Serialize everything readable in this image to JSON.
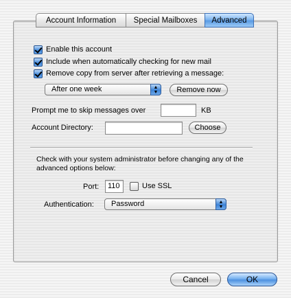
{
  "tabs": [
    {
      "label": "Account Information",
      "selected": false
    },
    {
      "label": "Special Mailboxes",
      "selected": false
    },
    {
      "label": "Advanced",
      "selected": true
    }
  ],
  "options": {
    "enable_account": {
      "label": "Enable this account",
      "checked": true
    },
    "include_auto_check": {
      "label": "Include when automatically checking for new mail",
      "checked": true
    },
    "remove_copy": {
      "label": "Remove copy from server after retrieving a message:",
      "checked": true
    }
  },
  "remove_after": {
    "selected": "After one week"
  },
  "remove_now_label": "Remove now",
  "skip_messages": {
    "label": "Prompt me to skip messages over",
    "value": "",
    "unit": "KB"
  },
  "account_directory": {
    "label": "Account Directory:",
    "value": "",
    "choose_label": "Choose"
  },
  "advanced_note": "Check with your system administrator before changing any of the advanced options below:",
  "port": {
    "label": "Port:",
    "value": "110"
  },
  "use_ssl": {
    "label": "Use SSL",
    "checked": false
  },
  "authentication": {
    "label": "Authentication:",
    "selected": "Password"
  },
  "footer": {
    "cancel_label": "Cancel",
    "ok_label": "OK"
  },
  "icons": {
    "popup_arrow": "updown-arrows-icon",
    "checkmark": "checkmark-icon"
  },
  "colors": {
    "accent": "#4e91e0",
    "accent_border": "#2a5697"
  }
}
